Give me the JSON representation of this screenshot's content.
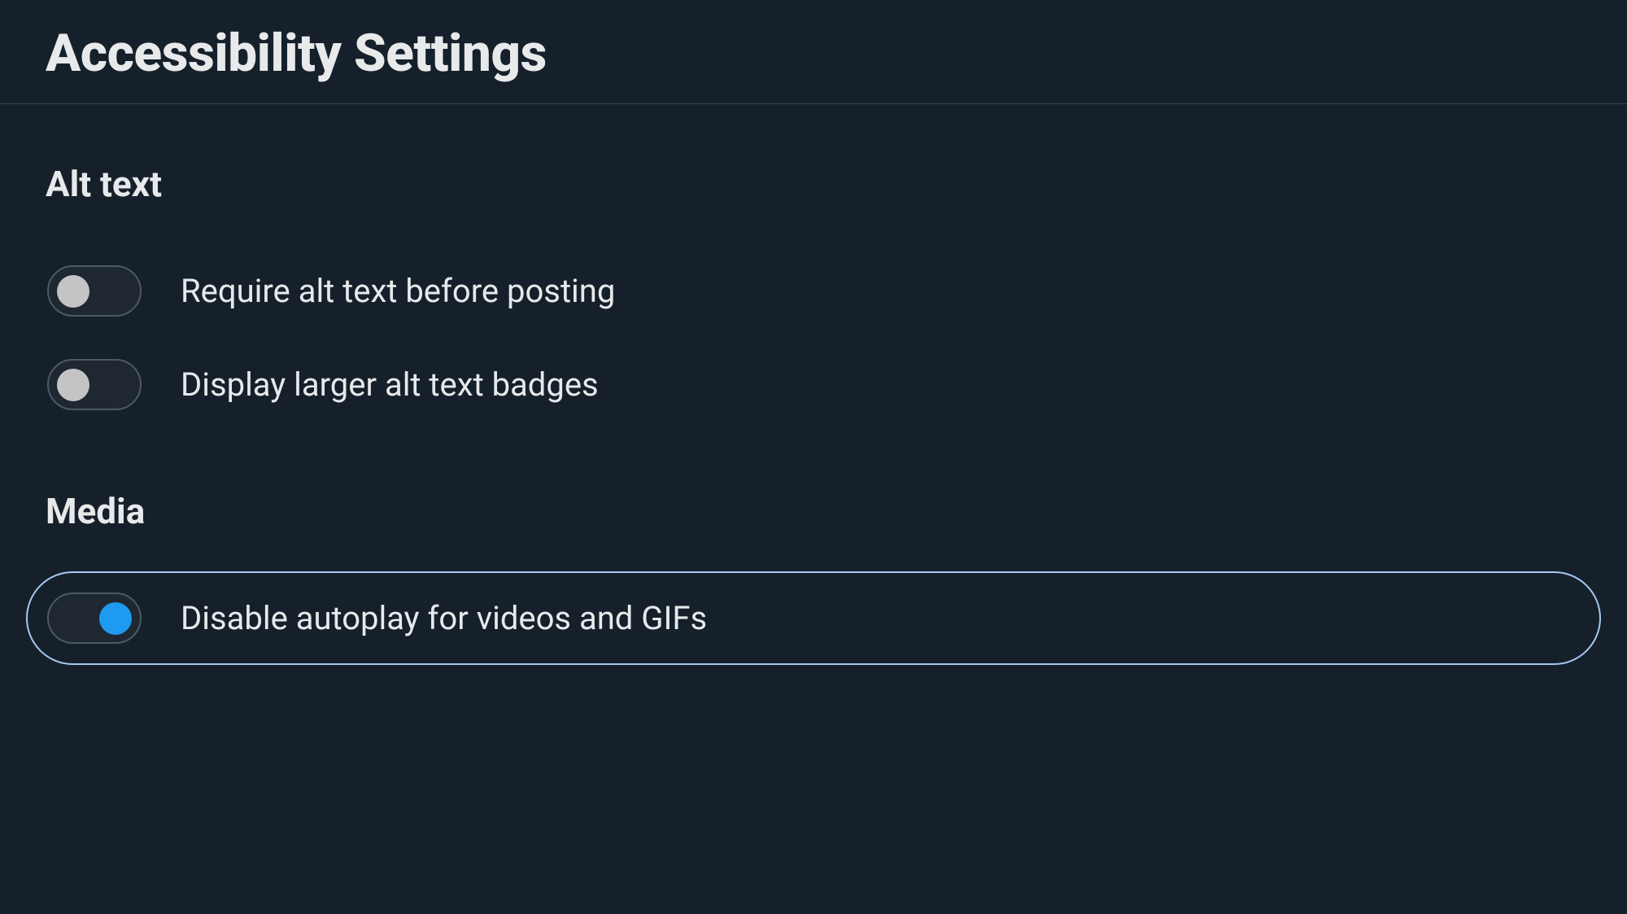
{
  "page": {
    "title": "Accessibility Settings"
  },
  "sections": {
    "altText": {
      "heading": "Alt text",
      "items": [
        {
          "label": "Require alt text before posting",
          "enabled": false,
          "focused": false
        },
        {
          "label": "Display larger alt text badges",
          "enabled": false,
          "focused": false
        }
      ]
    },
    "media": {
      "heading": "Media",
      "items": [
        {
          "label": "Disable autoplay for videos and GIFs",
          "enabled": true,
          "focused": true
        }
      ]
    }
  }
}
